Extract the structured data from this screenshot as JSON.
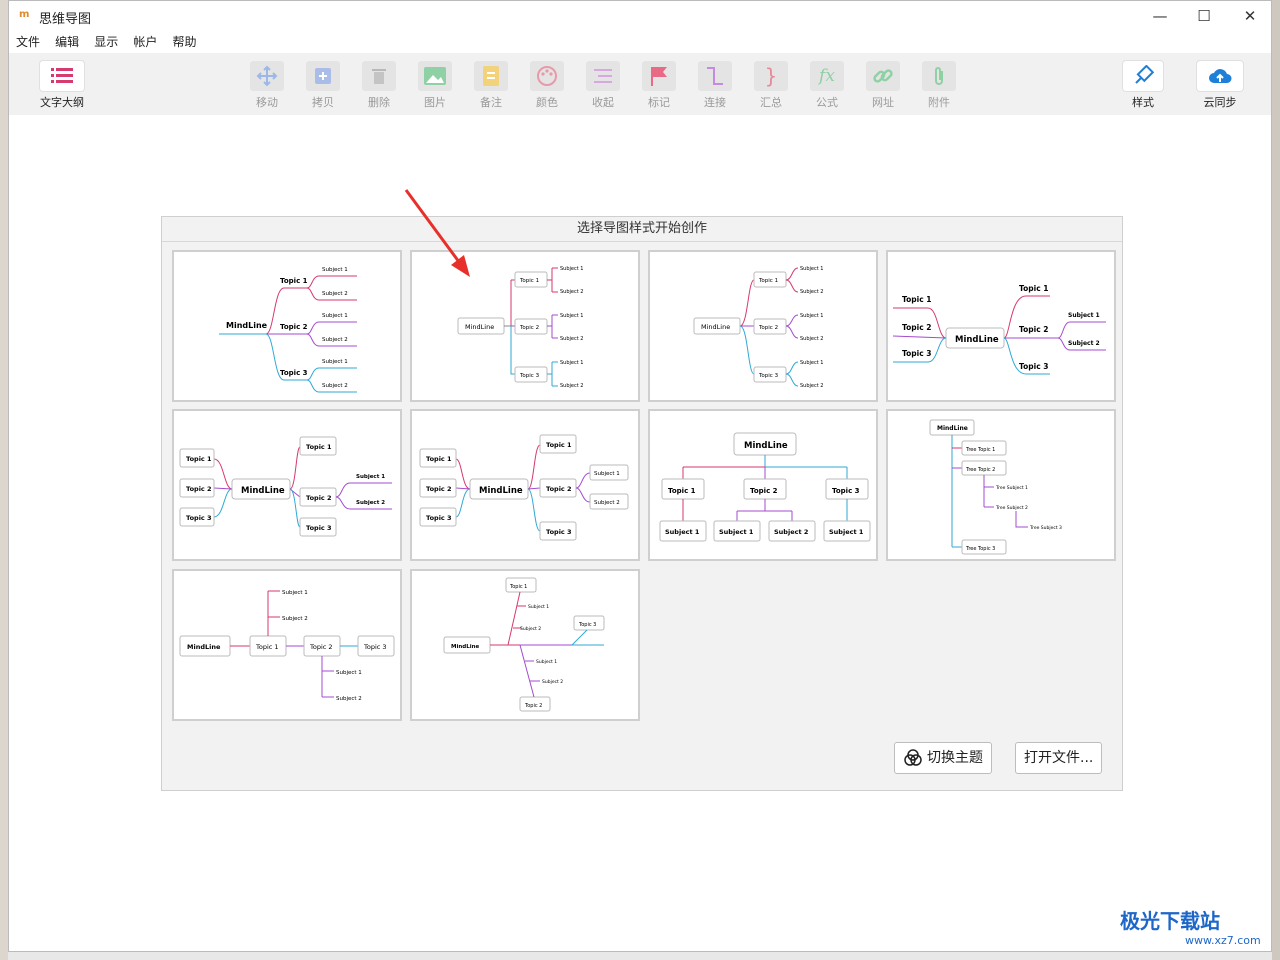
{
  "app": {
    "logo": "m",
    "title": "思维导图"
  },
  "window_controls": {
    "minimize": "—",
    "maximize": "☐",
    "close": "✕"
  },
  "menu": [
    "文件",
    "编辑",
    "显示",
    "帐户",
    "帮助"
  ],
  "toolbar": {
    "outline": "文字大纲",
    "tools": [
      "移动",
      "拷贝",
      "删除",
      "图片",
      "备注",
      "颜色",
      "收起",
      "标记",
      "连接",
      "汇总",
      "公式",
      "网址",
      "附件"
    ],
    "style": "样式",
    "cloud": "云同步"
  },
  "dialog": {
    "title": "选择导图样式开始创作",
    "switch_theme": "切换主题",
    "open_file": "打开文件..."
  },
  "templates": {
    "root": "MindLine",
    "t1": "Topic 1",
    "t2": "Topic 2",
    "t3": "Topic 3",
    "s1": "Subject 1",
    "s2": "Subject 2",
    "s3": "Subject 3",
    "tt1": "Tree Topic 1",
    "tt2": "Tree Topic 2",
    "tt3": "Tree Topic 3",
    "ts1": "Tree Subject 1",
    "ts2": "Tree Subject 2",
    "ts3": "Tree Subject 3"
  },
  "watermark": {
    "text": "极光下载站",
    "url": "www.xz7.com"
  },
  "colors": {
    "pink": "#d63a6e",
    "purple": "#a44bd0",
    "blue": "#2fa9d6"
  }
}
